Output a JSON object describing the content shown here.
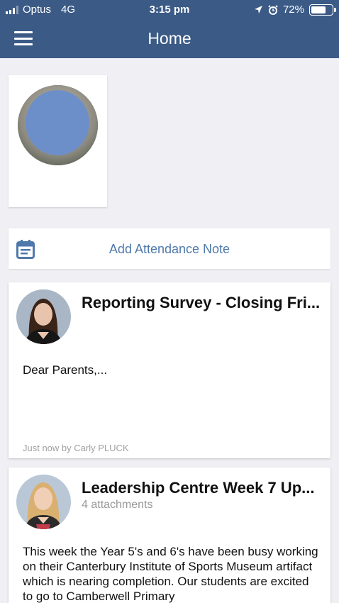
{
  "status_bar": {
    "carrier": "Optus",
    "network": "4G",
    "time": "3:15 pm",
    "battery": "72%",
    "battery_level": 0.72
  },
  "nav": {
    "title": "Home",
    "menu_icon": "hamburger-menu-icon"
  },
  "attendance": {
    "label": "Add Attendance Note",
    "icon": "calendar-icon"
  },
  "posts": [
    {
      "title": "Reporting Survey - Closing Fri...",
      "excerpt": "Dear Parents,...",
      "meta": "Just now by Carly PLUCK"
    },
    {
      "title": "Leadership Centre Week 7 Up...",
      "subtitle": "4 attachments",
      "excerpt": "This week the Year 5's and 6's have been busy working on their Canterbury Institute of Sports Museum artifact which is nearing completion. Our students are excited to go to Camberwell Primary"
    }
  ],
  "colors": {
    "header": "#3b5a86",
    "accent": "#4f79ab",
    "background": "#efeff4"
  }
}
